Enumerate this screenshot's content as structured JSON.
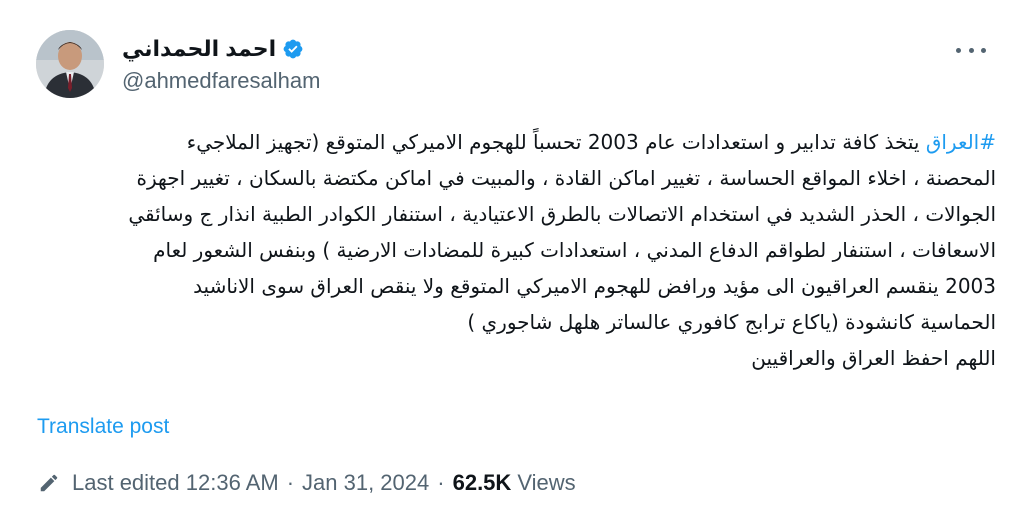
{
  "author": {
    "display_name": "احمد الحمداني",
    "handle": "@ahmedfaresalham",
    "verified": true,
    "avatar_icon": "profile-photo"
  },
  "menu": {
    "icon": "more-horizontal-icon"
  },
  "post": {
    "hashtag": "#العراق",
    "lines": [
      " يتخذ كافة تدابير و استعدادات عام 2003 تحسباً للهجوم الاميركي المتوقع (تجهيز الملاجيء",
      "المحصنة ، اخلاء المواقع الحساسة ، تغيير اماكن القادة ، والمبيت في اماكن مكتضة بالسكان ، تغيير اجهزة",
      "الجوالات ، الحذر الشديد في استخدام  الاتصالات بالطرق الاعتيادية ، استنفار الكوادر الطبية انذار ج وسائقي",
      "الاسعافات ، استنفار لطواقم الدفاع المدني ، استعدادات كبيرة للمضادات الارضية ) وبنفس الشعور لعام",
      "2003 ينقسم العراقيون الى مؤيد ورافض للهجوم الاميركي المتوقع ولا ينقص العراق سوى الاناشيد",
      "الحماسية كانشودة (ياكاع ترابج كافوري عالساتر هلهل شاجوري )",
      "اللهم احفظ العراق والعراقيين"
    ]
  },
  "translate_label": "Translate post",
  "meta": {
    "edited_label": "Last edited 12:36 AM",
    "separator": "·",
    "date": "Jan 31, 2024",
    "views_count": "62.5K",
    "views_label": "Views"
  },
  "colors": {
    "accent": "#1d9bf0",
    "secondary_text": "#536471",
    "primary_text": "#0f1419"
  }
}
